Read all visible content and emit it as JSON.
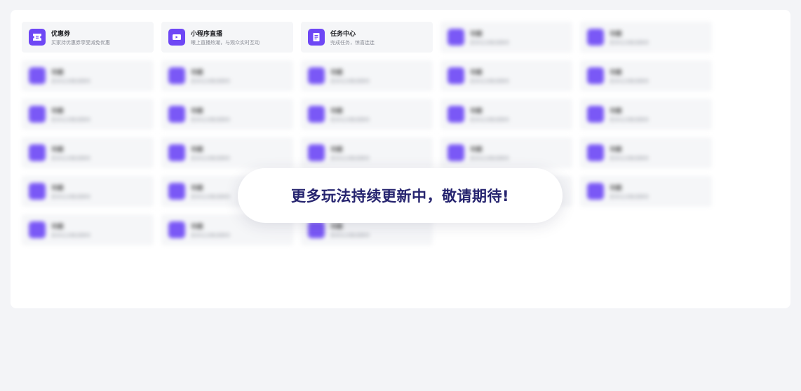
{
  "cards": [
    {
      "title": "优惠券",
      "desc": "买家持优惠券享受减免优惠",
      "icon": "ticket-icon"
    },
    {
      "title": "小程序直播",
      "desc": "眼上直播热潮，与观众实时互动",
      "icon": "video-icon"
    },
    {
      "title": "任务中心",
      "desc": "完成任务，惊喜连连",
      "icon": "document-icon"
    }
  ],
  "placeholder": {
    "title": "功能",
    "desc": "更多玩法敬请期待",
    "count": 25
  },
  "toast": {
    "message": "更多玩法持续更新中，敬请期待!"
  },
  "colors": {
    "accent": "#6e47f5",
    "toast_text": "#26246f",
    "card_bg": "#f5f6f8",
    "page_bg": "#f3f4f7"
  }
}
